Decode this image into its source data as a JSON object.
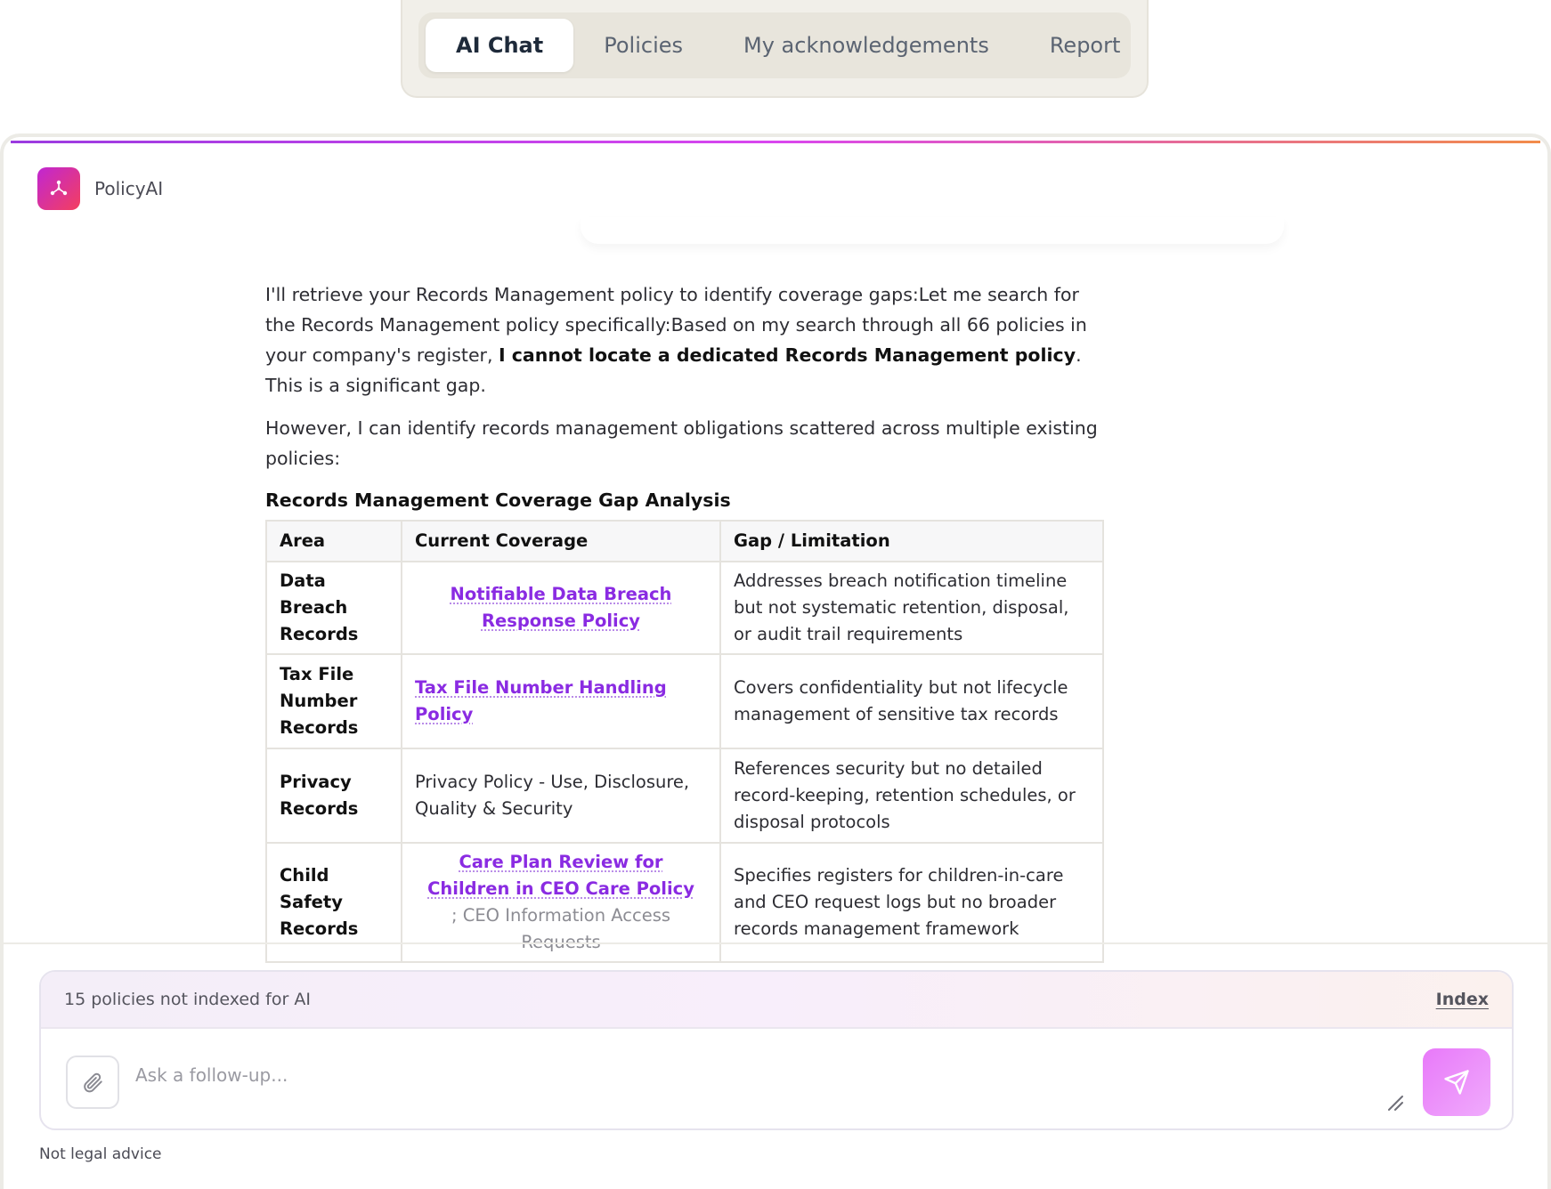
{
  "tabs": [
    {
      "label": "AI Chat",
      "active": true
    },
    {
      "label": "Policies",
      "active": false
    },
    {
      "label": "My acknowledgements",
      "active": false
    },
    {
      "label": "Report",
      "active": false
    }
  ],
  "brand": {
    "name": "PolicyAI",
    "icon": "network-nodes-icon"
  },
  "message": {
    "para1_a": "I'll retrieve your Records Management policy to identify coverage gaps:Let me search for the Records Management policy specifically:Based on my search through all 66 policies in your company's register, ",
    "para1_bold": "I cannot locate a dedicated Records Management policy",
    "para1_c": ". This is a significant gap.",
    "para2": "However, I can identify records management obligations scattered across multiple existing policies:",
    "section_title": "Records Management Coverage Gap Analysis",
    "table": {
      "headers": [
        "Area",
        "Current Coverage",
        "Gap / Limitation"
      ],
      "rows": [
        {
          "area": "Data Breach Records",
          "coverage_link": "Notifiable Data Breach Response Policy",
          "gap": "Addresses breach notification timeline but not systematic retention, disposal, or audit trail requirements"
        },
        {
          "area": "Tax File Number Records",
          "coverage_link": "Tax File Number Handling Policy",
          "gap": "Covers confidentiality but not lifecycle management of sensitive tax records"
        },
        {
          "area": "Privacy Records",
          "coverage_text": "Privacy Policy - Use, Disclosure, Quality & Security",
          "gap": "References security but no detailed record-keeping, retention schedules, or disposal protocols"
        },
        {
          "area": "Child Safety Records",
          "coverage_link": "Care Plan Review for Children in CEO Care Policy",
          "coverage_extra": "; CEO Information Access Requests",
          "gap": "Specifies registers for children-in-care and CEO request logs but no broader records management framework"
        }
      ]
    }
  },
  "composer": {
    "notice": "15 policies not indexed for AI",
    "notice_action": "Index",
    "placeholder": "Ask a follow-up...",
    "attach_icon": "paperclip-icon",
    "send_icon": "send-icon"
  },
  "disclaimer": "Not legal advice",
  "colors": {
    "accent": "#8a2be2",
    "brand_gradient_start": "#c026d3",
    "brand_gradient_end": "#f43f5e",
    "send_button": "#e879f9"
  }
}
